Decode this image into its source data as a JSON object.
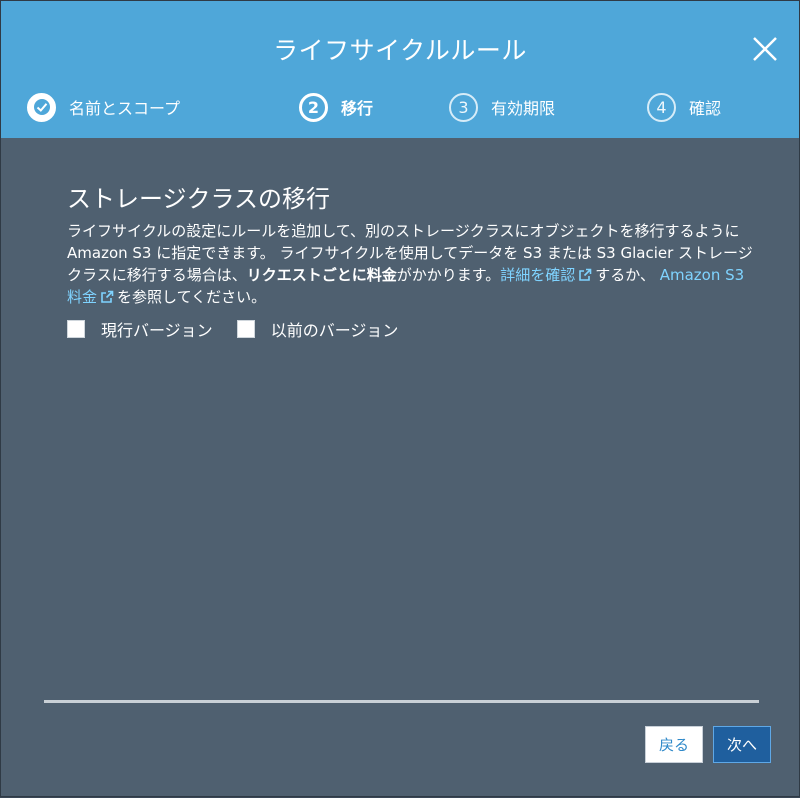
{
  "dialog": {
    "title": "ライフサイクルルール",
    "close_icon": "close-icon"
  },
  "steps": [
    {
      "number": "",
      "label": "名前とスコープ",
      "state": "done",
      "icon": "check-circle-icon"
    },
    {
      "number": "2",
      "label": "移行",
      "state": "active"
    },
    {
      "number": "3",
      "label": "有効期限",
      "state": "pending"
    },
    {
      "number": "4",
      "label": "確認",
      "state": "pending"
    }
  ],
  "section": {
    "title": "ストレージクラスの移行",
    "desc_part1": "ライフサイクルの設定にルールを追加して、別のストレージクラスにオブジェクトを移行するように Amazon S3 に指定できます。 ライフサイクルを使用してデータを S3 または S3 Glacier ストレージクラスに移行する場合は、",
    "desc_bold": "リクエストごとに料金",
    "desc_part2": "がかかります。",
    "link1": "詳細を確認",
    "desc_part3": "するか、",
    "link2": "Amazon S3 料金",
    "desc_part4": "を参照してください。",
    "external_icon": "external-link-icon"
  },
  "options": {
    "current_version": {
      "label": "現行バージョン",
      "checked": false
    },
    "previous_version": {
      "label": "以前のバージョン",
      "checked": false
    }
  },
  "footer": {
    "back_label": "戻る",
    "next_label": "次へ"
  },
  "colors": {
    "header": "#4fa7d9",
    "body": "#4f6070",
    "link": "#7fd3ff",
    "primary_button": "#1f5f9e"
  }
}
